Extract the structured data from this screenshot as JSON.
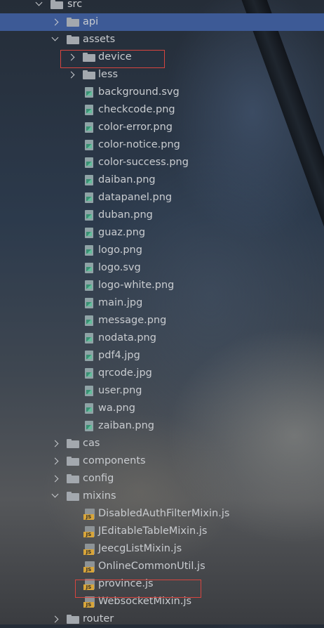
{
  "tree": {
    "src": "src",
    "api": "api",
    "assets": "assets",
    "device": "device",
    "less": "less",
    "assets_files": [
      "background.svg",
      "checkcode.png",
      "color-error.png",
      "color-notice.png",
      "color-success.png",
      "daiban.png",
      "datapanel.png",
      "duban.png",
      "guaz.png",
      "logo.png",
      "logo.svg",
      "logo-white.png",
      "main.jpg",
      "message.png",
      "nodata.png",
      "pdf4.jpg",
      "qrcode.jpg",
      "user.png",
      "wa.png",
      "zaiban.png"
    ],
    "cas": "cas",
    "components": "components",
    "config": "config",
    "mixins": "mixins",
    "mixins_files": [
      "DisabledAuthFilterMixin.js",
      "JEditableTableMixin.js",
      "JeecgListMixin.js",
      "OnlineCommonUtil.js",
      "province.js",
      "WebsocketMixin.js"
    ],
    "router": "router",
    "js_badge": "JS"
  },
  "colors": {
    "selection": "#3d5a96",
    "highlight_box": "#d8453f",
    "js_badge": "#d8a53a"
  }
}
